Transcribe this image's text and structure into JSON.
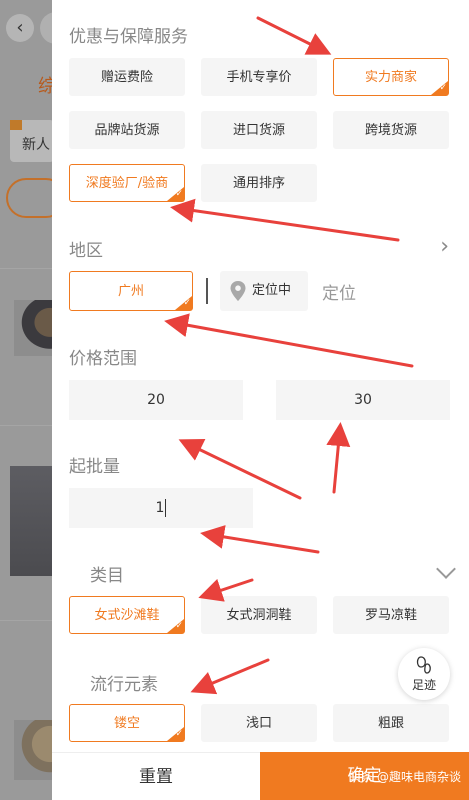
{
  "background": {
    "back_glyph": "‹",
    "tab_partial": "综",
    "new_tag": "新人"
  },
  "sections": {
    "service": {
      "title": "优惠与保障服务",
      "options": [
        {
          "label": "赠运费险",
          "selected": false
        },
        {
          "label": "手机专享价",
          "selected": false
        },
        {
          "label": "实力商家",
          "selected": true
        },
        {
          "label": "品牌站货源",
          "selected": false
        },
        {
          "label": "进口货源",
          "selected": false
        },
        {
          "label": "跨境货源",
          "selected": false
        },
        {
          "label": "深度验厂/验商",
          "selected": true
        },
        {
          "label": "通用排序",
          "selected": false
        }
      ]
    },
    "region": {
      "title": "地区",
      "selected_city": "广州",
      "locating_label": "定位中",
      "locate_label": "定位"
    },
    "price": {
      "title": "价格范围",
      "min": "20",
      "max": "30"
    },
    "moq": {
      "title": "起批量",
      "value": "1"
    },
    "category": {
      "title": "类目",
      "options": [
        {
          "label": "女式沙滩鞋",
          "selected": true
        },
        {
          "label": "女式洞洞鞋",
          "selected": false
        },
        {
          "label": "罗马凉鞋",
          "selected": false
        }
      ]
    },
    "trend": {
      "title": "流行元素",
      "options": [
        {
          "label": "镂空",
          "selected": true
        },
        {
          "label": "浅口",
          "selected": false
        },
        {
          "label": "粗跟",
          "selected": false
        }
      ]
    }
  },
  "footprint_label": "足迹",
  "footer": {
    "reset_label": "重置",
    "confirm_label": "确定"
  },
  "watermark": "头条 @趣味电商杂谈",
  "colors": {
    "accent": "#f07a20",
    "annotation_arrow": "#e8413c"
  },
  "icons": [
    "back-icon",
    "chevron-right-icon",
    "location-pin-icon",
    "chevron-down-icon",
    "footprint-icon",
    "check-icon"
  ]
}
